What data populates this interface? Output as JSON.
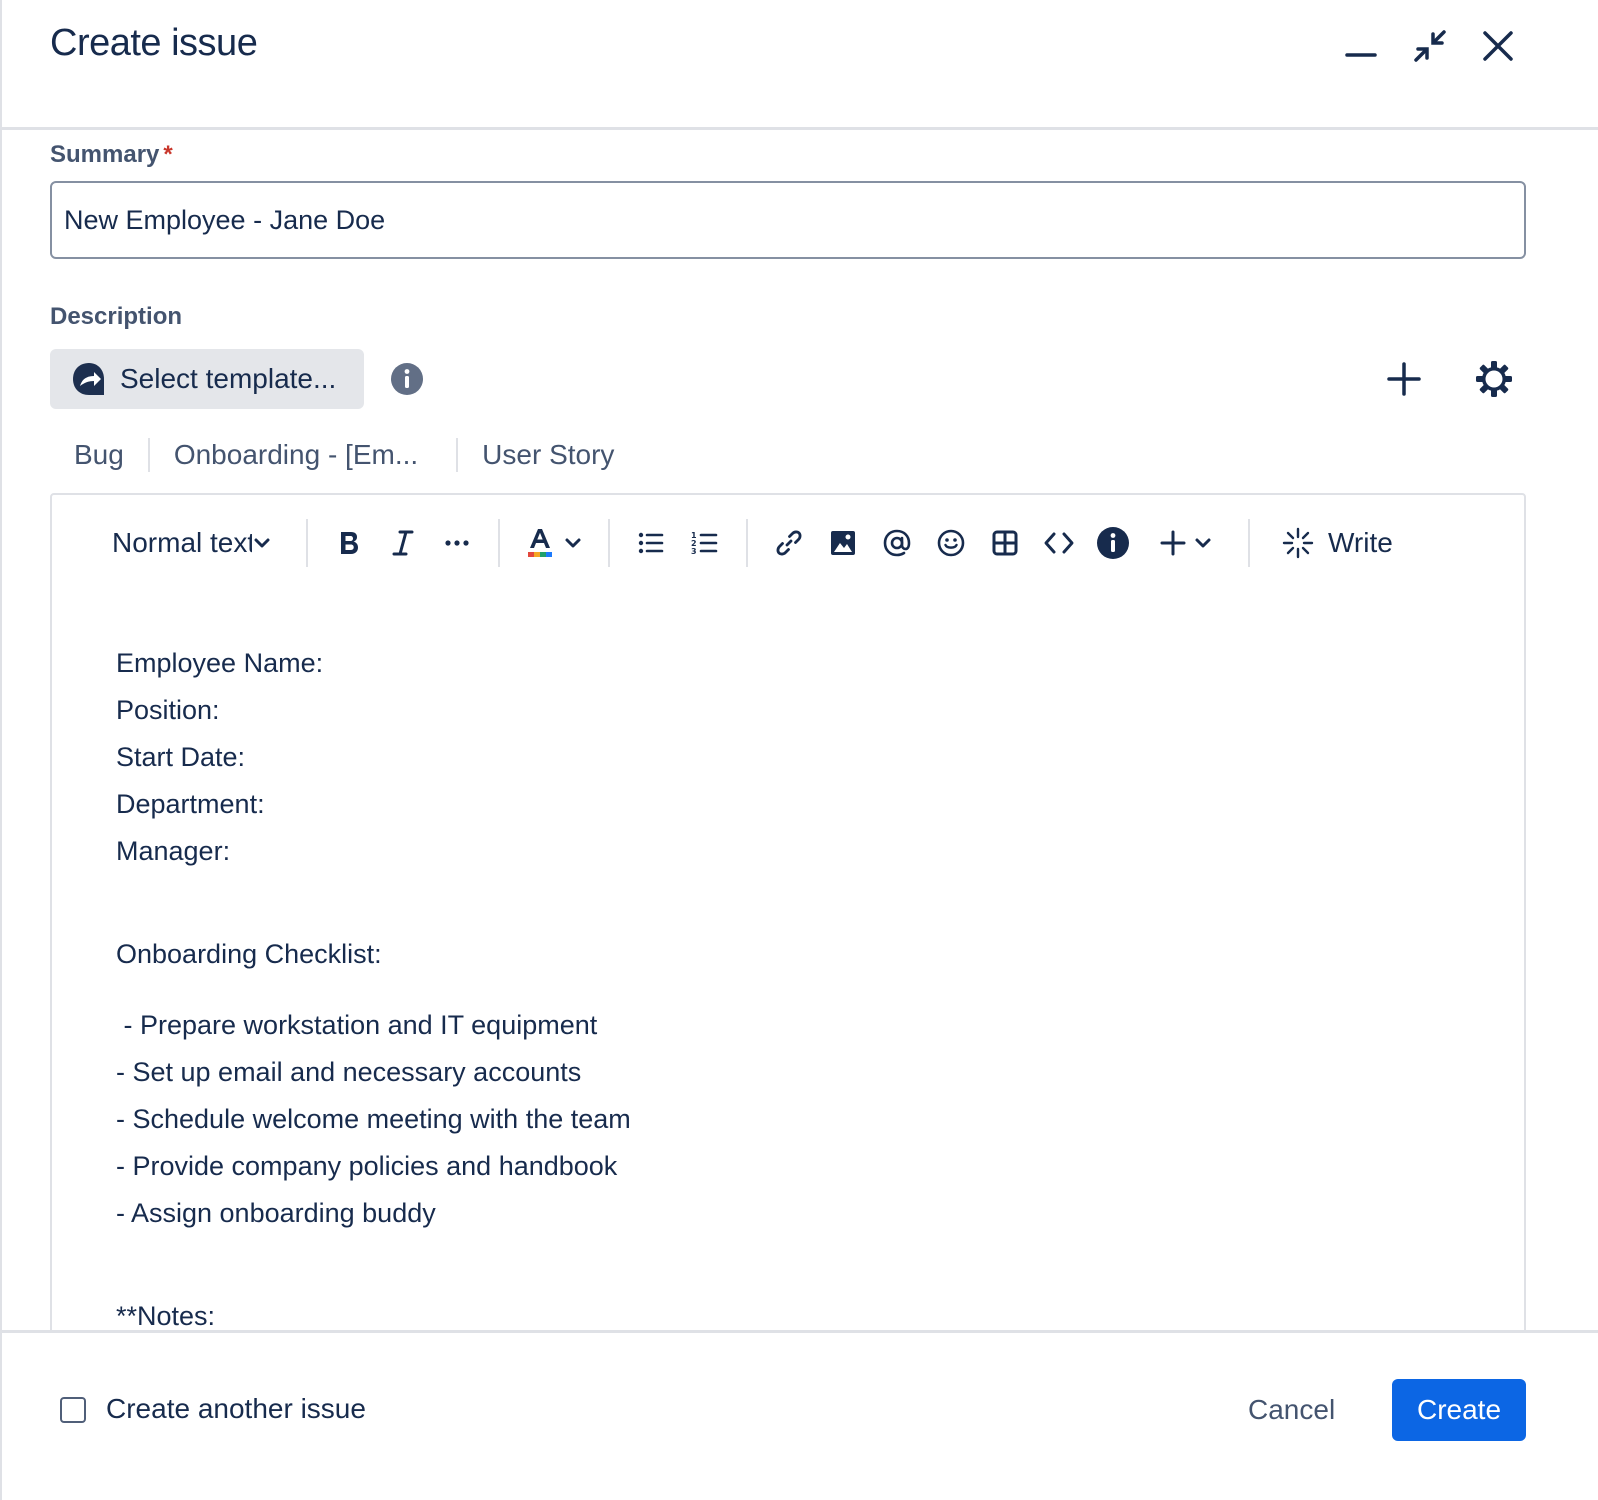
{
  "header": {
    "title": "Create issue",
    "minimize": "minimize-icon",
    "collapse": "collapse-icon",
    "close": "close-icon"
  },
  "summary": {
    "label": "Summary",
    "required_mark": "*",
    "value": "New Employee - Jane Doe"
  },
  "description": {
    "label": "Description",
    "select_template": "Select template...",
    "template_tabs": [
      {
        "label": "Bug"
      },
      {
        "label": "Onboarding - [Em..."
      },
      {
        "label": "User Story"
      }
    ]
  },
  "toolbar": {
    "text_style": "Normal text",
    "write_label": "Write"
  },
  "editor": {
    "lines_top": [
      "Employee Name:",
      "Position:",
      "Start Date:",
      "Department:",
      "Manager:"
    ],
    "checklist_title": "Onboarding Checklist:",
    "checklist": [
      " - Prepare workstation and IT equipment",
      "- Set up email and necessary accounts",
      "- Schedule welcome meeting with the team",
      "- Provide company policies and handbook",
      "- Assign onboarding buddy"
    ],
    "notes": "**Notes:"
  },
  "footer": {
    "create_another": "Create another issue",
    "cancel": "Cancel",
    "create": "Create"
  },
  "colors": {
    "primary": "#0c66e4",
    "text": "#172b4d",
    "subtle": "#44546f",
    "required": "#c9372c"
  }
}
